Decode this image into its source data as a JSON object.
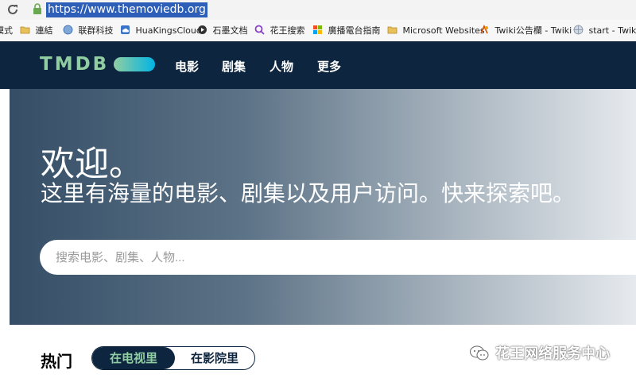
{
  "browser": {
    "url": "https://www.themoviedb.org",
    "bookmarks": [
      {
        "label": "模式",
        "icon": "page-icon"
      },
      {
        "label": "連結",
        "icon": "folder-icon"
      },
      {
        "label": "联群科技",
        "icon": "globe-icon"
      },
      {
        "label": "HuaKingsCloud",
        "icon": "cloud-icon"
      },
      {
        "label": "石墨文档",
        "icon": "shimo-icon"
      },
      {
        "label": "花王搜索",
        "icon": "search-icon"
      },
      {
        "label": "廣播電台指南",
        "icon": "windows-icon"
      },
      {
        "label": "Microsoft Websites",
        "icon": "folder-icon"
      },
      {
        "label": "Twiki公告欄 - Twiki",
        "icon": "twiki-icon"
      },
      {
        "label": "start - Twiki",
        "icon": "globe-icon"
      }
    ]
  },
  "header": {
    "logo": "TMDB",
    "nav": [
      "电影",
      "剧集",
      "人物",
      "更多"
    ]
  },
  "hero": {
    "title": "欢迎。",
    "subtitle": "这里有海量的电影、剧集以及用户访问。快来探索吧。",
    "search_placeholder": "搜索电影、剧集、人物..."
  },
  "trending": {
    "title": "热门",
    "tabs": [
      "在电视里",
      "在影院里"
    ],
    "active": 0
  },
  "watermark": {
    "text": "花王网络服务中心"
  }
}
